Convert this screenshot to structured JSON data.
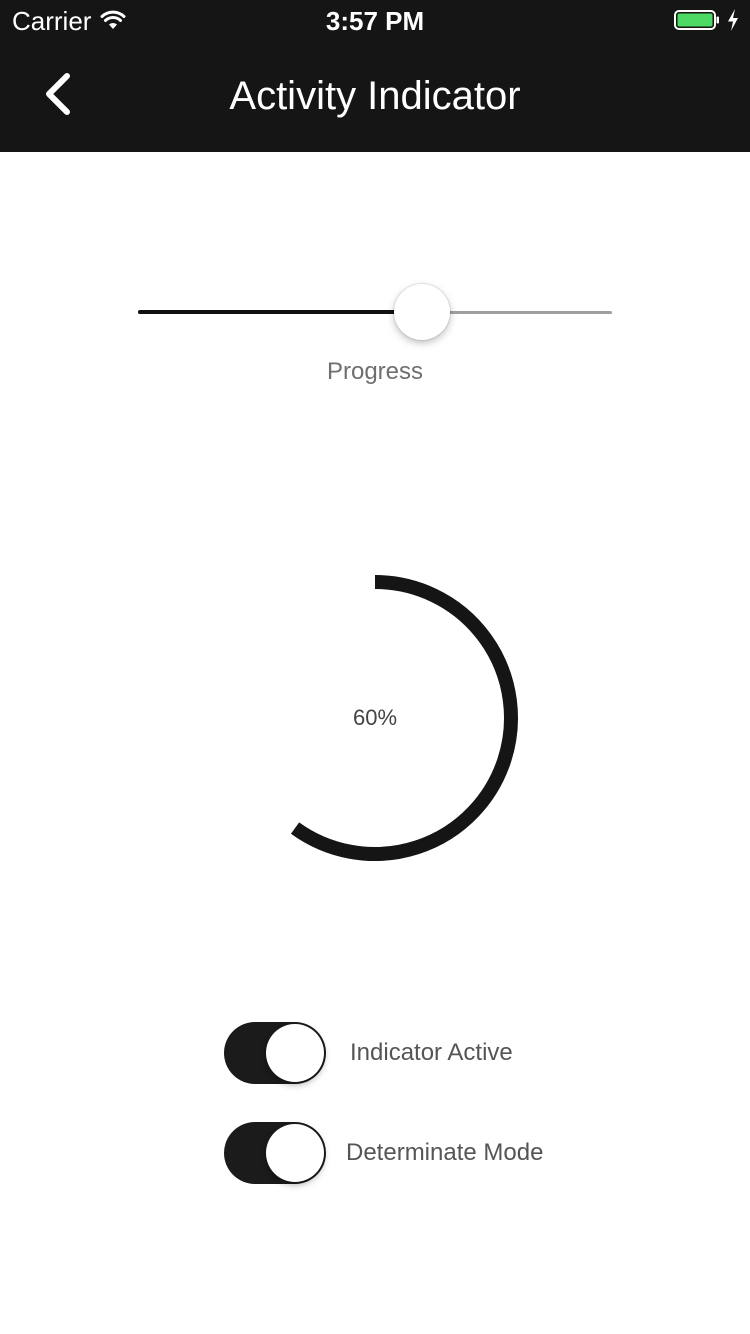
{
  "status_bar": {
    "carrier": "Carrier",
    "time": "3:57 PM",
    "battery_color": "#4cd964",
    "icons": [
      "wifi-icon",
      "battery-icon",
      "charging-bolt-icon"
    ]
  },
  "nav": {
    "title": "Activity Indicator",
    "back_icon": "chevron-left-icon"
  },
  "slider": {
    "label": "Progress",
    "value_fraction": 0.6
  },
  "indicator": {
    "text": "60%",
    "progress_fraction": 0.6,
    "color": "#151515"
  },
  "switches": [
    {
      "label": "Indicator Active",
      "on": true
    },
    {
      "label": "Determinate Mode",
      "on": true
    }
  ]
}
